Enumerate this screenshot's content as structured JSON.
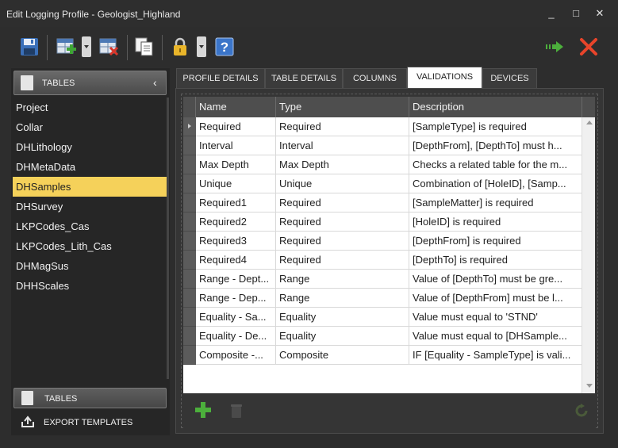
{
  "window": {
    "title": "Edit Logging Profile - Geologist_Highland",
    "controls": {
      "minimize": "_",
      "maximize": "□",
      "close": "✕"
    }
  },
  "toolbar": {
    "buttons": [
      {
        "name": "save",
        "icon": "save-icon"
      },
      {
        "name": "add-table",
        "icon": "add-table-icon"
      },
      {
        "name": "delete-table",
        "icon": "delete-table-icon"
      },
      {
        "name": "copy",
        "icon": "copy-icon"
      },
      {
        "name": "lock",
        "icon": "lock-icon"
      },
      {
        "name": "help",
        "icon": "help-icon"
      },
      {
        "name": "proceed",
        "icon": "arrow-right-icon"
      },
      {
        "name": "close",
        "icon": "close-icon"
      }
    ]
  },
  "sidebar": {
    "header": "TABLES",
    "tables": [
      "Project",
      "Collar",
      "DHLithology",
      "DHMetaData",
      "DHSamples",
      "DHSurvey",
      "LKPCodes_Cas",
      "LKPCodes_Lith_Cas",
      "DHMagSus",
      "DHHScales"
    ],
    "selected": "DHSamples",
    "nav": {
      "tables": "TABLES",
      "export_templates": "EXPORT TEMPLATES"
    }
  },
  "tabs": [
    "PROFILE DETAILS",
    "TABLE DETAILS",
    "COLUMNS",
    "VALIDATIONS",
    "DEVICES"
  ],
  "active_tab": "VALIDATIONS",
  "grid": {
    "columns": [
      "Name",
      "Type",
      "Description"
    ],
    "rows": [
      [
        "Required",
        "Required",
        "[SampleType] is required"
      ],
      [
        "Interval",
        "Interval",
        "[DepthFrom], [DepthTo] must h..."
      ],
      [
        "Max Depth",
        "Max Depth",
        "Checks a related table for the m..."
      ],
      [
        "Unique",
        "Unique",
        "Combination of [HoleID], [Samp..."
      ],
      [
        "Required1",
        "Required",
        "[SampleMatter] is required"
      ],
      [
        "Required2",
        "Required",
        "[HoleID] is required"
      ],
      [
        "Required3",
        "Required",
        "[DepthFrom] is required"
      ],
      [
        "Required4",
        "Required",
        "[DepthTo] is required"
      ],
      [
        "Range - Dept...",
        "Range",
        "Value of [DepthTo] must be gre..."
      ],
      [
        "Range - Dep...",
        "Range",
        "Value of [DepthFrom] must be l..."
      ],
      [
        "Equality - Sa...",
        "Equality",
        "Value must equal to 'STND'"
      ],
      [
        "Equality - De...",
        "Equality",
        "Value must equal to [DHSample..."
      ],
      [
        "Composite -...",
        "Composite",
        "IF [Equality - SampleType] is vali..."
      ]
    ]
  },
  "colors": {
    "selected_table": "#f5d15a",
    "add_green": "#4caf3c",
    "close_red": "#e8442a",
    "header_bg": "#4e4e4e"
  }
}
